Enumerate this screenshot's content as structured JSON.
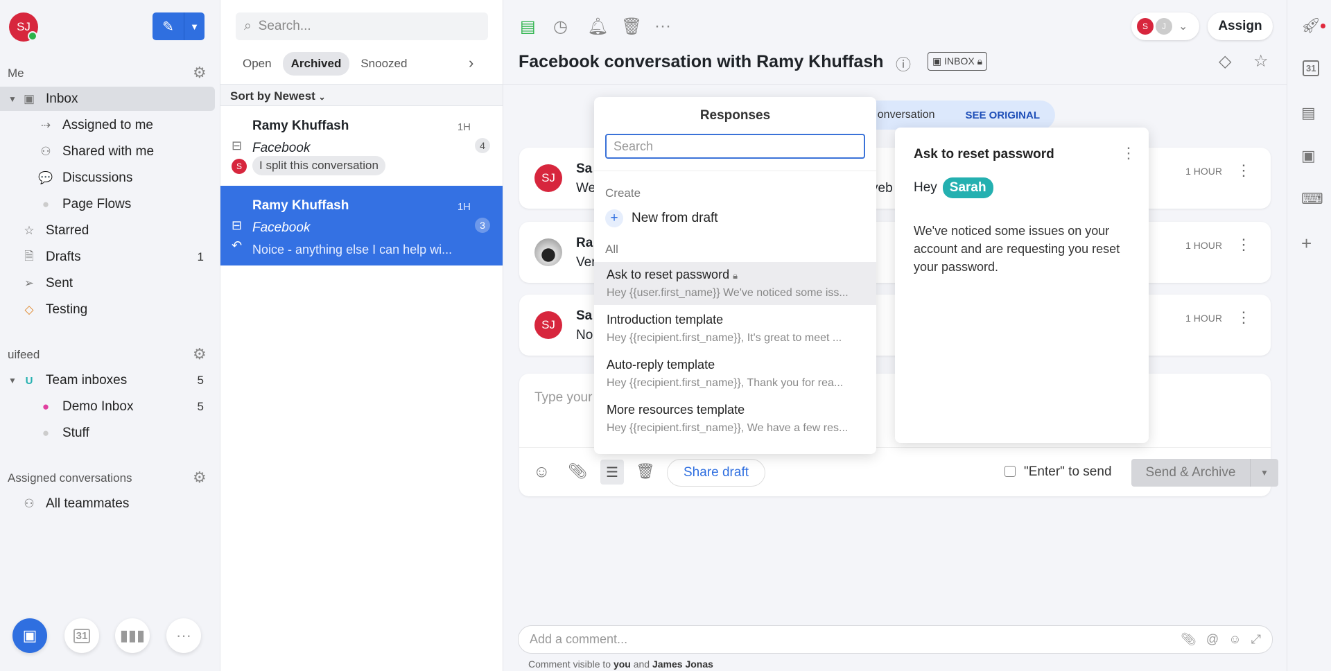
{
  "sidebar": {
    "avatar_initials": "SJ",
    "me_label": "Me",
    "me_items": [
      {
        "label": "Inbox",
        "icon": "inbox-icon"
      },
      {
        "label": "Assigned to me",
        "icon": "assigned-icon"
      },
      {
        "label": "Shared with me",
        "icon": "shared-icon"
      },
      {
        "label": "Discussions",
        "icon": "chat-icon"
      },
      {
        "label": "Page Flows",
        "icon": "dot-icon"
      },
      {
        "label": "Starred",
        "icon": "star-icon"
      },
      {
        "label": "Drafts",
        "icon": "draft-icon",
        "count": "1"
      },
      {
        "label": "Sent",
        "icon": "send-icon"
      },
      {
        "label": "Testing",
        "icon": "tag-icon"
      }
    ],
    "team_section": "uifeed",
    "team_label": "Team inboxes",
    "team_badge": "U",
    "team_count": "5",
    "team_items": [
      {
        "label": "Demo Inbox",
        "count": "5",
        "color": "#e040a0"
      },
      {
        "label": "Stuff",
        "color": "#cccccc"
      }
    ],
    "assigned_section": "Assigned conversations",
    "assigned_item": "All teammates"
  },
  "list": {
    "search_placeholder": "Search...",
    "tabs": [
      "Open",
      "Archived",
      "Snoozed"
    ],
    "active_tab": "Archived",
    "sort": "Sort by Newest",
    "conversations": [
      {
        "name": "Ramy Khuffash",
        "time": "1H",
        "channel": "Facebook",
        "count": "4",
        "preview": "I split this conversation",
        "preview_avatar": "S",
        "selected": false
      },
      {
        "name": "Ramy Khuffash",
        "time": "1H",
        "channel": "Facebook",
        "count": "3",
        "preview": "Noice - anything else I can help wi...",
        "selected": true
      }
    ]
  },
  "header": {
    "title": "Facebook conversation with Ramy Khuffash",
    "inbox_tag": "INBOX",
    "assignees": [
      "S",
      "J"
    ],
    "assign_label": "Assign"
  },
  "banner": {
    "text": "onversation",
    "link": "SEE ORIGINAL"
  },
  "messages": [
    {
      "initials": "SJ",
      "name": "Sa",
      "snippet": "We",
      "tail": "veb",
      "time": "1 HOUR"
    },
    {
      "initials": "",
      "name": "Ra",
      "snippet": "Ver",
      "time": "1 HOUR"
    },
    {
      "initials": "SJ",
      "name": "Sa",
      "snippet": "No",
      "time": "1 HOUR"
    }
  ],
  "composer": {
    "placeholder": "Type your",
    "share_draft": "Share draft",
    "enter_to_send": "\"Enter\" to send",
    "send_label": "Send & Archive"
  },
  "responses": {
    "title": "Responses",
    "search_placeholder": "Search",
    "create_label": "Create",
    "new_from_draft": "New from draft",
    "all_label": "All",
    "items": [
      {
        "title": "Ask to reset password",
        "preview": "Hey {{user.first_name}} We've noticed some iss...",
        "locked": true
      },
      {
        "title": "Introduction template",
        "preview": "Hey {{recipient.first_name}}, It's great to meet ..."
      },
      {
        "title": "Auto-reply template",
        "preview": "Hey {{recipient.first_name}}, Thank you for rea..."
      },
      {
        "title": "More resources template",
        "preview": "Hey {{recipient.first_name}}, We have a few res..."
      }
    ]
  },
  "preview": {
    "title": "Ask to reset password",
    "greeting": "Hey",
    "name_chip": "Sarah",
    "body": "We've noticed some issues on your account and are requesting you reset your password."
  },
  "comment": {
    "placeholder": "Add a comment...",
    "note_prefix": "Comment visible to ",
    "note_you": "you",
    "note_and": " and ",
    "note_name": "James Jonas"
  },
  "colors": {
    "accent": "#2f6fe0",
    "selected_row": "#3471e3",
    "avatar_red": "#d7263d",
    "chip_teal": "#24b0b0",
    "archive_green": "#2bb34a"
  }
}
